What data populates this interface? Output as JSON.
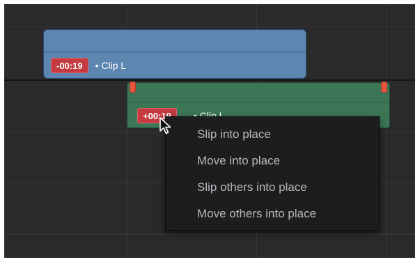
{
  "timeline": {
    "upper_clip": {
      "offset": "-00:19",
      "name": "• Clip L",
      "color": "#5d86b1"
    },
    "lower_clip": {
      "offset": "+00:19",
      "name": "• Clip L",
      "color": "#3b7757"
    }
  },
  "context_menu": {
    "items": [
      {
        "label": "Slip into place"
      },
      {
        "label": "Move into place"
      },
      {
        "label": "Slip others into place"
      },
      {
        "label": "Move others into place"
      }
    ]
  },
  "cursor": "arrow-pointer-icon"
}
